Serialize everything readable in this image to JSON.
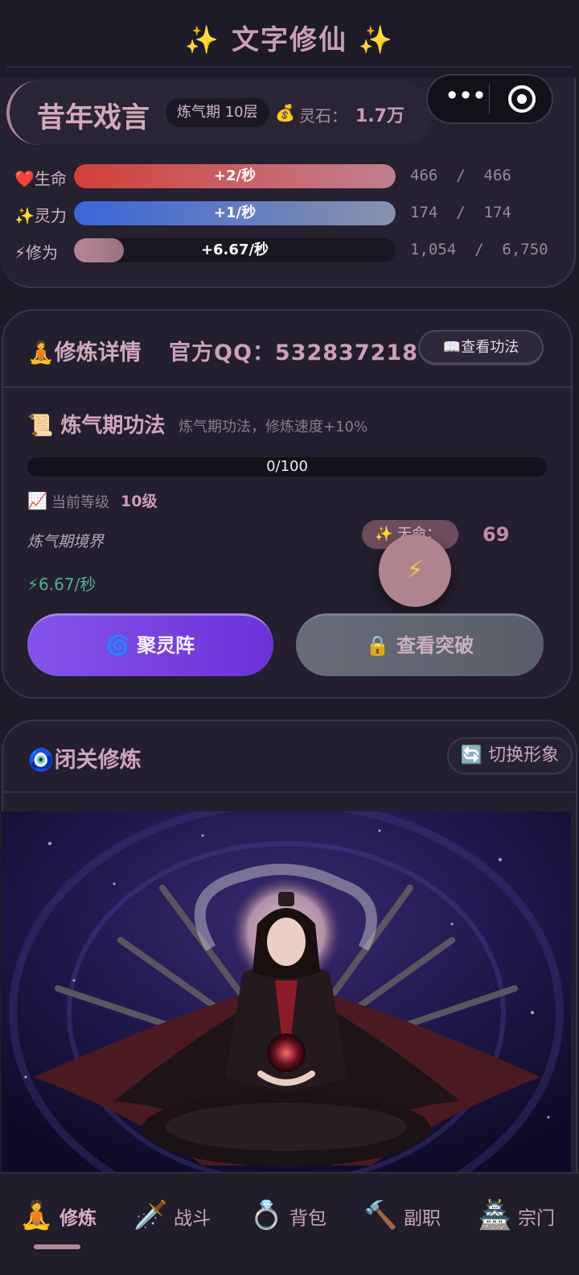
{
  "app": {
    "title": "✨ 文字修仙 ✨"
  },
  "player": {
    "name": "昔年戏言",
    "realm": "炼气期 10层",
    "stone_icon": "💰",
    "stone_label": "灵石：",
    "stone_value": "1.7万"
  },
  "stats": [
    {
      "label": "❤️生命",
      "rate": "+2/秒",
      "values": "466  /  466",
      "fill": 1.0
    },
    {
      "label": "✨灵力",
      "rate": "+1/秒",
      "values": "174  /  174",
      "fill": 1.0
    },
    {
      "label": "⚡修为",
      "rate": "+6.67/秒",
      "values": "1,054  /  6,750",
      "fill": 0.156
    }
  ],
  "cultivation": {
    "title": "🧘修炼详情",
    "qq": "官方QQ：532837218",
    "view_skill_button": "📖查看功法",
    "skill_title": "📜 炼气期功法",
    "skill_desc": "炼气期功法，修炼速度+10%",
    "progress_text": "0/100",
    "progress_fraction": 0,
    "level_icon": "📈",
    "level_label": "当前等级",
    "level_value": "10级",
    "realm_text": "炼气期境界",
    "life_label": "✨ 天命：",
    "life_value": "69",
    "float_icon": "⚡",
    "rate": "⚡6.67/秒",
    "gather_button": "🌀 聚灵阵",
    "breakthrough_button": "🔒 查看突破"
  },
  "seclusion": {
    "title": "🧿闭关修炼",
    "switch_button": "🔄 切换形象"
  },
  "nav": [
    {
      "icon": "🧘",
      "label": "修炼",
      "active": true
    },
    {
      "icon": "🗡️",
      "label": "战斗",
      "active": false
    },
    {
      "icon": "💍",
      "label": "背包",
      "active": false
    },
    {
      "icon": "🔨",
      "label": "副职",
      "active": false
    },
    {
      "icon": "🏯",
      "label": "宗门",
      "active": false
    }
  ],
  "colors": {
    "background": "#1e1b29",
    "accent": "#c79db0",
    "hp": "#d2403a",
    "mp": "#3a66d8",
    "gather_button": "#7b44e2",
    "rate_green": "#4fb489"
  }
}
